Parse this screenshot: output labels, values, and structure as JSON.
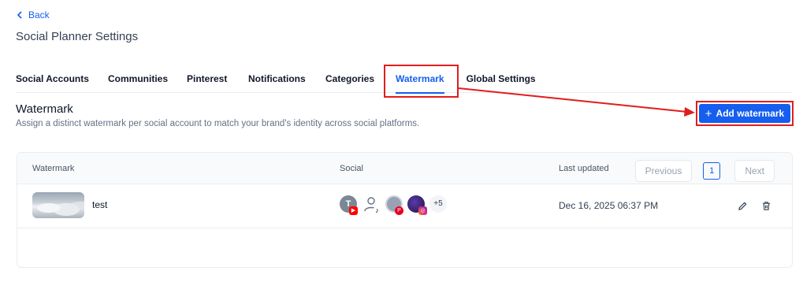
{
  "header": {
    "back_label": "Back",
    "title": "Social Planner Settings"
  },
  "tabs": [
    {
      "label": "Social Accounts",
      "active": false
    },
    {
      "label": "Communities",
      "active": false
    },
    {
      "label": "Pinterest",
      "active": false
    },
    {
      "label": "Notifications",
      "active": false
    },
    {
      "label": "Categories",
      "active": false
    },
    {
      "label": "Watermark",
      "active": true
    },
    {
      "label": "Global Settings",
      "active": false
    }
  ],
  "section": {
    "title": "Watermark",
    "description": "Assign a distinct watermark per social account to match your brand's identity across social platforms.",
    "add_button_label": "Add watermark"
  },
  "table": {
    "columns": [
      "Watermark",
      "Social",
      "Last updated"
    ],
    "rows": [
      {
        "name": "test",
        "social": {
          "avatars": [
            {
              "initial": "T",
              "network": "youtube"
            },
            {
              "initial": "",
              "network": "tiktok"
            },
            {
              "initial": "",
              "network": "pinterest"
            },
            {
              "initial": "",
              "network": "instagram"
            }
          ],
          "extra_count": "+5"
        },
        "last_updated": "Dec 16, 2025 06:37 PM"
      }
    ]
  },
  "pagination": {
    "previous_label": "Previous",
    "current_page": "1",
    "next_label": "Next"
  },
  "colors": {
    "primary": "#155eef",
    "annotation_red": "#e11d1d"
  }
}
